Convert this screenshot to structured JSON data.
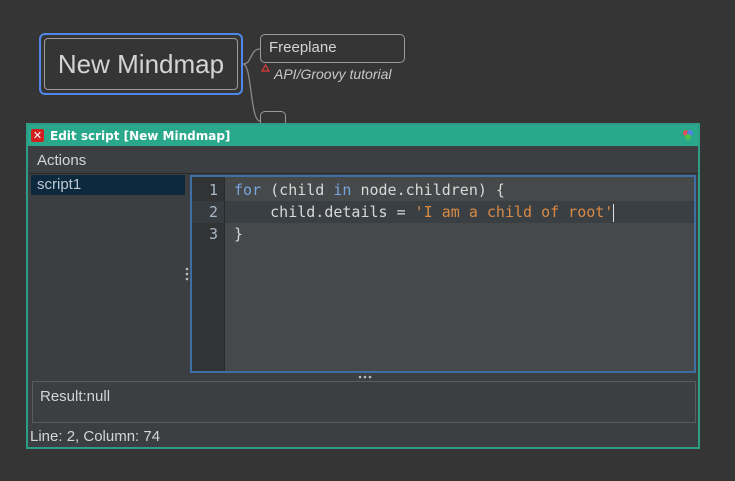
{
  "mindmap": {
    "root_label": "New Mindmap",
    "child_label": "Freeplane",
    "child_details": "API/Groovy tutorial"
  },
  "dialog": {
    "title": "Edit script [New Mindmap]",
    "menu": {
      "actions_label": "Actions"
    },
    "scripts": [
      "script1"
    ],
    "editor": {
      "lines": [
        {
          "number": "1",
          "tokens": [
            {
              "t": "for",
              "c": "kw"
            },
            {
              "t": " (child ",
              "c": "txt"
            },
            {
              "t": "in",
              "c": "kw"
            },
            {
              "t": " node.children) {",
              "c": "txt"
            }
          ]
        },
        {
          "number": "2",
          "tokens": [
            {
              "t": "    child.details = ",
              "c": "txt"
            },
            {
              "t": "'I am a child of root'",
              "c": "str"
            }
          ]
        },
        {
          "number": "3",
          "tokens": [
            {
              "t": "}",
              "c": "txt"
            }
          ]
        }
      ],
      "current_line": 2
    },
    "result_text": "Result:null",
    "status_text": "Line: 2, Column: 74"
  },
  "colors": {
    "title_bar": "#2aa88c",
    "root_border": "#4f86e8",
    "keyword": "#7aa4dc",
    "string": "#d98a45"
  },
  "icons": [
    "close-icon",
    "app-corner-icon",
    "details-triangle-icon",
    "splitter-grip-icon"
  ]
}
